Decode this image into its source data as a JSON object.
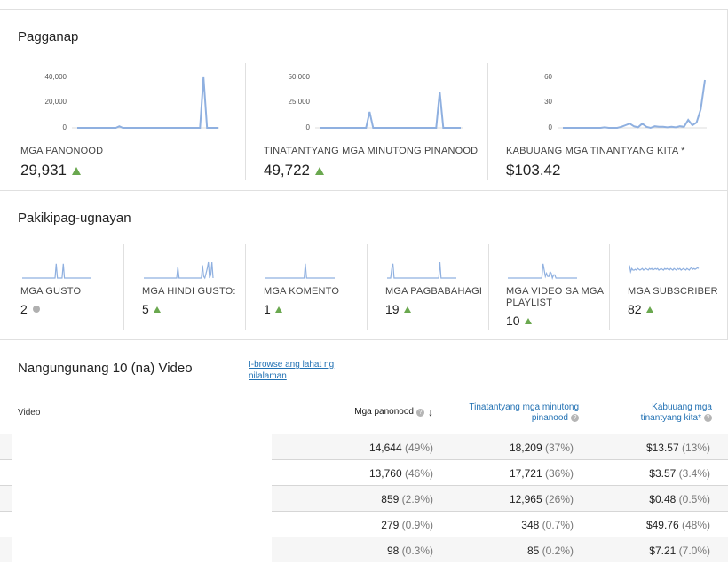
{
  "performance": {
    "title": "Pagganap",
    "metrics": [
      {
        "label": "MGA PANONOOD",
        "value": "29,931",
        "trend": "up",
        "axis": [
          "40,000",
          "20,000",
          "0"
        ],
        "spark": [
          0,
          0,
          0,
          0,
          0,
          0,
          0,
          0,
          0,
          0,
          0,
          0,
          0.03,
          0,
          0,
          0,
          0,
          0,
          0,
          0,
          0,
          0,
          0,
          0,
          0,
          0,
          0,
          0,
          0,
          0,
          0,
          0,
          0,
          0,
          0,
          0,
          0.95,
          0,
          0,
          0,
          0
        ]
      },
      {
        "label": "TINATANTYANG MGA MINUTONG PINANOOD",
        "value": "49,722",
        "trend": "up",
        "axis": [
          "50,000",
          "25,000",
          "0"
        ],
        "spark": [
          0,
          0,
          0,
          0,
          0,
          0,
          0,
          0,
          0,
          0,
          0,
          0,
          0,
          0,
          0.3,
          0,
          0,
          0,
          0,
          0,
          0,
          0,
          0,
          0,
          0,
          0,
          0,
          0,
          0,
          0,
          0,
          0,
          0,
          0,
          0.68,
          0,
          0,
          0,
          0,
          0,
          0
        ]
      },
      {
        "label": "KABUUANG MGA TINANTYANG KITA *",
        "value": "$103.42",
        "trend": "none",
        "axis": [
          "60",
          "30",
          "0"
        ],
        "spark": [
          0,
          0,
          0,
          0,
          0,
          0,
          0,
          0,
          0,
          0,
          0.01,
          0,
          0,
          0,
          0.02,
          0.05,
          0.08,
          0.03,
          0.01,
          0.08,
          0.02,
          0,
          0.03,
          0.02,
          0.02,
          0.01,
          0.02,
          0.01,
          0.03,
          0.02,
          0.15,
          0.05,
          0.1,
          0.35,
          0.9
        ]
      }
    ]
  },
  "engagement": {
    "title": "Pakikipag-ugnayan",
    "metrics": [
      {
        "label": "MGA GUSTO",
        "value": "2",
        "trend": "flat",
        "spark": [
          0,
          0,
          0,
          0,
          0,
          0,
          0,
          0,
          0,
          0,
          0,
          0,
          0,
          0,
          0,
          0,
          0,
          0,
          0,
          0,
          0,
          0,
          0,
          0,
          0,
          0,
          0,
          0,
          0,
          0.9,
          0,
          0,
          0,
          0,
          0,
          0.9,
          0,
          0,
          0,
          0,
          0,
          0,
          0,
          0,
          0,
          0,
          0,
          0,
          0,
          0,
          0,
          0,
          0,
          0,
          0,
          0,
          0,
          0,
          0,
          0
        ]
      },
      {
        "label": "MGA HINDI GUSTO:",
        "value": "5",
        "trend": "up",
        "spark": [
          0,
          0,
          0,
          0,
          0,
          0,
          0,
          0,
          0,
          0,
          0,
          0,
          0,
          0,
          0,
          0,
          0,
          0,
          0,
          0,
          0,
          0,
          0,
          0,
          0,
          0,
          0,
          0,
          0,
          0.7,
          0,
          0,
          0,
          0,
          0,
          0,
          0,
          0,
          0,
          0,
          0,
          0,
          0,
          0,
          0,
          0,
          0,
          0,
          0,
          0,
          0.8,
          0.1,
          0,
          0.3,
          0.6,
          1,
          0,
          0.2,
          1,
          0
        ]
      },
      {
        "label": "MGA KOMENTO",
        "value": "1",
        "trend": "up",
        "spark": [
          0,
          0,
          0,
          0,
          0,
          0,
          0,
          0,
          0,
          0,
          0,
          0,
          0,
          0,
          0,
          0,
          0,
          0,
          0,
          0,
          0,
          0,
          0,
          0,
          0,
          0,
          0,
          0,
          0,
          0,
          0,
          0,
          0,
          0,
          0.9,
          0,
          0,
          0,
          0,
          0,
          0,
          0,
          0,
          0,
          0,
          0,
          0,
          0,
          0,
          0,
          0,
          0,
          0,
          0,
          0,
          0,
          0,
          0,
          0,
          0
        ]
      },
      {
        "label": "MGA PAGBABAHAGI",
        "value": "19",
        "trend": "up",
        "spark": [
          0,
          0,
          0,
          0,
          0.6,
          0.9,
          0,
          0,
          0,
          0,
          0,
          0,
          0,
          0,
          0,
          0,
          0,
          0,
          0,
          0,
          0,
          0,
          0,
          0,
          0,
          0,
          0,
          0,
          0,
          0,
          0,
          0,
          0,
          0,
          0,
          0,
          0,
          0,
          0,
          0,
          0,
          0,
          0,
          0,
          0,
          1,
          0,
          0,
          0,
          0,
          0,
          0,
          0,
          0,
          0,
          0,
          0,
          0,
          0,
          0
        ]
      },
      {
        "label": "MGA VIDEO SA MGA PLAYLIST",
        "value": "10",
        "trend": "up",
        "spark": [
          0,
          0,
          0,
          0,
          0,
          0,
          0,
          0,
          0,
          0,
          0,
          0,
          0,
          0,
          0,
          0,
          0,
          0,
          0,
          0,
          0,
          0,
          0,
          0,
          0,
          0,
          0,
          0,
          0,
          0,
          0.9,
          0.5,
          0.1,
          0.3,
          0.1,
          0.1,
          0.4,
          0.3,
          0,
          0.2,
          0.2,
          0,
          0,
          0,
          0,
          0,
          0,
          0,
          0,
          0,
          0,
          0,
          0,
          0,
          0,
          0,
          0,
          0,
          0,
          0
        ]
      },
      {
        "label": "MGA SUBSCRIBER",
        "value": "82",
        "trend": "up",
        "spark": [
          0.8,
          0.4,
          0.6,
          0.5,
          0.5,
          0.55,
          0.5,
          0.6,
          0.55,
          0.5,
          0.55,
          0.6,
          0.5,
          0.55,
          0.6,
          0.55,
          0.5,
          0.6,
          0.55,
          0.6,
          0.5,
          0.55,
          0.6,
          0.55,
          0.6,
          0.5,
          0.55,
          0.6,
          0.55,
          0.5,
          0.6,
          0.55,
          0.6,
          0.55,
          0.5,
          0.6,
          0.55,
          0.5,
          0.6,
          0.55,
          0.5,
          0.6,
          0.55,
          0.6,
          0.5,
          0.55,
          0.6,
          0.55,
          0.5,
          0.6,
          0.55,
          0.5,
          0.6,
          0.65,
          0.55,
          0.6,
          0.55,
          0.6,
          0.65,
          0.6
        ]
      }
    ]
  },
  "top_videos": {
    "title": "Nangungunang 10 (na) Video",
    "browse_link": "I-browse ang lahat ng nilalaman",
    "columns": {
      "video": "Video",
      "views": "Mga panonood",
      "minutes": "Tinatantyang mga minutong pinanood",
      "earnings": "Kabuuang mga tinantyang kita*"
    },
    "rows": [
      {
        "views": "14,644",
        "views_pct": "(49%)",
        "minutes": "18,209",
        "minutes_pct": "(37%)",
        "earnings": "$13.57",
        "earnings_pct": "(13%)"
      },
      {
        "views": "13,760",
        "views_pct": "(46%)",
        "minutes": "17,721",
        "minutes_pct": "(36%)",
        "earnings": "$3.57",
        "earnings_pct": "(3.4%)"
      },
      {
        "views": "859",
        "views_pct": "(2.9%)",
        "minutes": "12,965",
        "minutes_pct": "(26%)",
        "earnings": "$0.48",
        "earnings_pct": "(0.5%)"
      },
      {
        "views": "279",
        "views_pct": "(0.9%)",
        "minutes": "348",
        "minutes_pct": "(0.7%)",
        "earnings": "$49.76",
        "earnings_pct": "(48%)"
      },
      {
        "views": "98",
        "views_pct": "(0.3%)",
        "minutes": "85",
        "minutes_pct": "(0.2%)",
        "earnings": "$7.21",
        "earnings_pct": "(7.0%)"
      }
    ]
  },
  "colors": {
    "spark_line": "#8fb0e0",
    "trend_up": "#6aa84f",
    "link": "#2271b3"
  }
}
